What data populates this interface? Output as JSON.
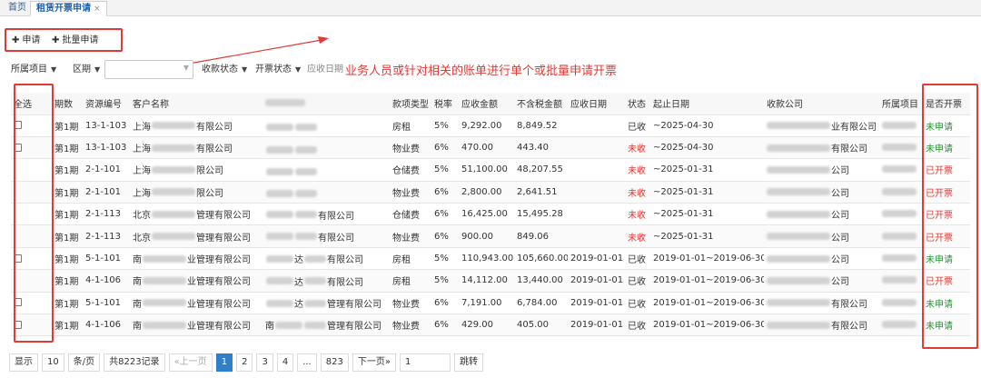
{
  "tabs": [
    {
      "label": "首页"
    },
    {
      "label": "租赁开票申请",
      "close": "×"
    }
  ],
  "toolbar": {
    "apply_label": "申请",
    "batch_label": "批量申请"
  },
  "filters": {
    "project": "所属项目",
    "period": "区期",
    "collection_status": "收款状态",
    "invoice_status": "开票状态",
    "due_date": "应收日期"
  },
  "annotation": "业务人员或针对相关的账单进行单个或批量申请开票",
  "table": {
    "headers": {
      "select_all": "全选",
      "period": "期数",
      "resource_no": "资源编号",
      "customer": "客户名称",
      "fee_type": "款项类型",
      "tax_rate": "税率",
      "amount": "应收金额",
      "amount_ex_tax": "不含税金额",
      "due_date": "应收日期",
      "status": "状态",
      "date_range": "起止日期",
      "payee": "收款公司",
      "project": "所属项目",
      "invoiced": "是否开票"
    },
    "rows": [
      {
        "period": "第1期",
        "resource_no": "13-1-103",
        "cust_a": "上海",
        "cust_b": "有限公司",
        "party_a": "",
        "party_b": "",
        "party_c": "",
        "fee_type": "房租",
        "tax_rate": "5%",
        "amount": "9,292.00",
        "amount_ex_tax": "8,849.52",
        "due_date": "",
        "status": "已收",
        "date_range": "~2025-04-30",
        "payee_b": "业有限公司",
        "invoiced": "未申请"
      },
      {
        "period": "第1期",
        "resource_no": "13-1-103",
        "cust_a": "上海",
        "cust_b": "有限公司",
        "party_a": "",
        "party_b": "",
        "party_c": "",
        "fee_type": "物业费",
        "tax_rate": "6%",
        "amount": "470.00",
        "amount_ex_tax": "443.40",
        "due_date": "",
        "status": "未收",
        "date_range": "~2025-04-30",
        "payee_b": "有限公司",
        "invoiced": "未申请"
      },
      {
        "period": "第1期",
        "resource_no": "2-1-101",
        "cust_a": "上海",
        "cust_b": "限公司",
        "party_a": "",
        "party_b": "",
        "party_c": "",
        "fee_type": "仓储费",
        "tax_rate": "5%",
        "amount": "51,100.00",
        "amount_ex_tax": "48,207.55",
        "due_date": "",
        "status": "未收",
        "date_range": "~2025-01-31",
        "payee_b": "公司",
        "invoiced": "已开票"
      },
      {
        "period": "第1期",
        "resource_no": "2-1-101",
        "cust_a": "上海",
        "cust_b": "限公司",
        "party_a": "",
        "party_b": "",
        "party_c": "",
        "fee_type": "物业费",
        "tax_rate": "6%",
        "amount": "2,800.00",
        "amount_ex_tax": "2,641.51",
        "due_date": "",
        "status": "未收",
        "date_range": "~2025-01-31",
        "payee_b": "公司",
        "invoiced": "已开票"
      },
      {
        "period": "第1期",
        "resource_no": "2-1-113",
        "cust_a": "北京",
        "cust_b": "管理有限公司",
        "party_a": "",
        "party_b": "",
        "party_c": "有限公司",
        "fee_type": "仓储费",
        "tax_rate": "6%",
        "amount": "16,425.00",
        "amount_ex_tax": "15,495.28",
        "due_date": "",
        "status": "未收",
        "date_range": "~2025-01-31",
        "payee_b": "公司",
        "invoiced": "已开票"
      },
      {
        "period": "第1期",
        "resource_no": "2-1-113",
        "cust_a": "北京",
        "cust_b": "管理有限公司",
        "party_a": "",
        "party_b": "",
        "party_c": "有限公司",
        "fee_type": "物业费",
        "tax_rate": "6%",
        "amount": "900.00",
        "amount_ex_tax": "849.06",
        "due_date": "",
        "status": "未收",
        "date_range": "~2025-01-31",
        "payee_b": "公司",
        "invoiced": "已开票"
      },
      {
        "period": "第1期",
        "resource_no": "5-1-101",
        "cust_a": "南",
        "cust_b": "业管理有限公司",
        "party_a": "",
        "party_b": "达",
        "party_c": "有限公司",
        "fee_type": "房租",
        "tax_rate": "5%",
        "amount": "110,943.00",
        "amount_ex_tax": "105,660.00",
        "due_date": "2019-01-01",
        "status": "已收",
        "date_range": "2019-01-01~2019-06-30",
        "payee_b": "公司",
        "invoiced": "未申请"
      },
      {
        "period": "第1期",
        "resource_no": "4-1-106",
        "cust_a": "南",
        "cust_b": "业管理有限公司",
        "party_a": "",
        "party_b": "达",
        "party_c": "有限公司",
        "fee_type": "房租",
        "tax_rate": "5%",
        "amount": "14,112.00",
        "amount_ex_tax": "13,440.00",
        "due_date": "2019-01-01",
        "status": "已收",
        "date_range": "2019-01-01~2019-06-30",
        "payee_b": "公司",
        "invoiced": "已开票"
      },
      {
        "period": "第1期",
        "resource_no": "5-1-101",
        "cust_a": "南",
        "cust_b": "业管理有限公司",
        "party_a": "",
        "party_b": "达",
        "party_c": "管理有限公司",
        "fee_type": "物业费",
        "tax_rate": "6%",
        "amount": "7,191.00",
        "amount_ex_tax": "6,784.00",
        "due_date": "2019-01-01",
        "status": "已收",
        "date_range": "2019-01-01~2019-06-30",
        "payee_b": "有限公司",
        "invoiced": "未申请"
      },
      {
        "period": "第1期",
        "resource_no": "4-1-106",
        "cust_a": "南",
        "cust_b": "业管理有限公司",
        "party_a": "南",
        "party_b": "",
        "party_c": "管理有限公司",
        "fee_type": "物业费",
        "tax_rate": "6%",
        "amount": "429.00",
        "amount_ex_tax": "405.00",
        "due_date": "2019-01-01",
        "status": "已收",
        "date_range": "2019-01-01~2019-06-30",
        "payee_b": "有限公司",
        "invoiced": "未申请"
      }
    ],
    "checkbox_rows": [
      true,
      true,
      false,
      false,
      false,
      false,
      true,
      false,
      true,
      true
    ]
  },
  "pager": {
    "show_label": "显示",
    "page_size": "10",
    "per_page_label": "条/页",
    "total_label": "共8223记录",
    "prev": "«上一页",
    "pages": [
      "1",
      "2",
      "3",
      "4",
      "...",
      "823"
    ],
    "next": "下一页»",
    "jump_value": "1",
    "jump_label": "跳转"
  },
  "colors": {
    "accent": "#2f80c9",
    "highlight": "#e53935",
    "green": "#1e9a2e",
    "red": "#e53935"
  }
}
